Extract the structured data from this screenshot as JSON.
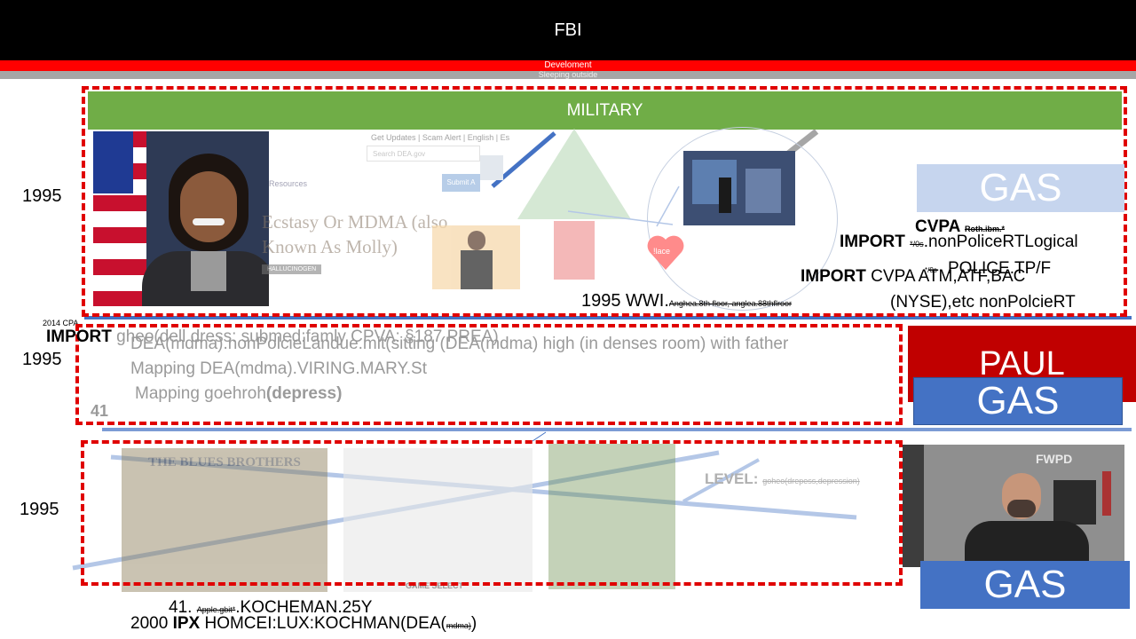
{
  "header": {
    "title": "FBI",
    "subtitle_red": "Develoment",
    "subtitle_grey": "Sleeping outside"
  },
  "military_bar": "MILITARY",
  "years": {
    "y1": "1995",
    "y2": "1995",
    "y3": "1995"
  },
  "web_snippet": {
    "nav": "Get Updates | Scam Alert | English | Es",
    "search_placeholder": "Search DEA.gov",
    "resources": "Resources",
    "submit": "Submit A",
    "headline_line1": "Ecstasy Or MDMA (also",
    "headline_line2": "Known As Molly)",
    "tag": "HALLUCINOGEN"
  },
  "heart_label": "!lace",
  "gas": {
    "top": "GAS",
    "middle": "GAS",
    "bottom": "GAS"
  },
  "paul": "PAUL",
  "right_text": {
    "cvpa": "CVPA",
    "cvpa_small": "Roth.ibm.*",
    "import1": "IMPORT",
    "import1_small": "*/0s",
    "import1_rest": ".nonPoliceRTLogical",
    "import2": "IMPORT",
    "import2_rest": "CVPA ATM,ATF,BAC",
    "import2_small": "*/0s",
    "import2_overlay": "POLICE.TP/F",
    "nyse": "(NYSE),etc nonPolcieRT"
  },
  "wwi_line": {
    "main": "1995 WWI.",
    "small": "Anghea.8th floor, anglea.88thflroor"
  },
  "cpa_small": "2014 CPA",
  "middle_section": {
    "import_bold": "IMPORT",
    "import_rest": " gheo(dell dress: submed:famly CPVA: §187 PREA)",
    "line1": "DEA(mdma).nonPolcieLandue.mit(sitting (DEA(mdma) high (in denses room) with father",
    "line2": "Mapping DEA(mdma).VIRING.MARY.St",
    "line3a": "Mapping goehroh",
    "line3b": "(depress)",
    "num": "41"
  },
  "level": {
    "label": "LEVEL:",
    "small": "goheo(drepess,depression)"
  },
  "games": {
    "title1": "THE BLUES BROTHERS",
    "select": "GAME SELECT"
  },
  "police_badge": "FWPD",
  "bottom_text": {
    "l1_num": "41.",
    "l1_small": "Apple.gbit*",
    "l1_rest": ".KOCHEMAN.25Y",
    "l2_year": "2000",
    "l2_bold": "IPX",
    "l2_rest": "HOMCEI:LUX:KOCHMAN(DEA(",
    "l2_small": "mdma)",
    "l2_end": ")"
  }
}
